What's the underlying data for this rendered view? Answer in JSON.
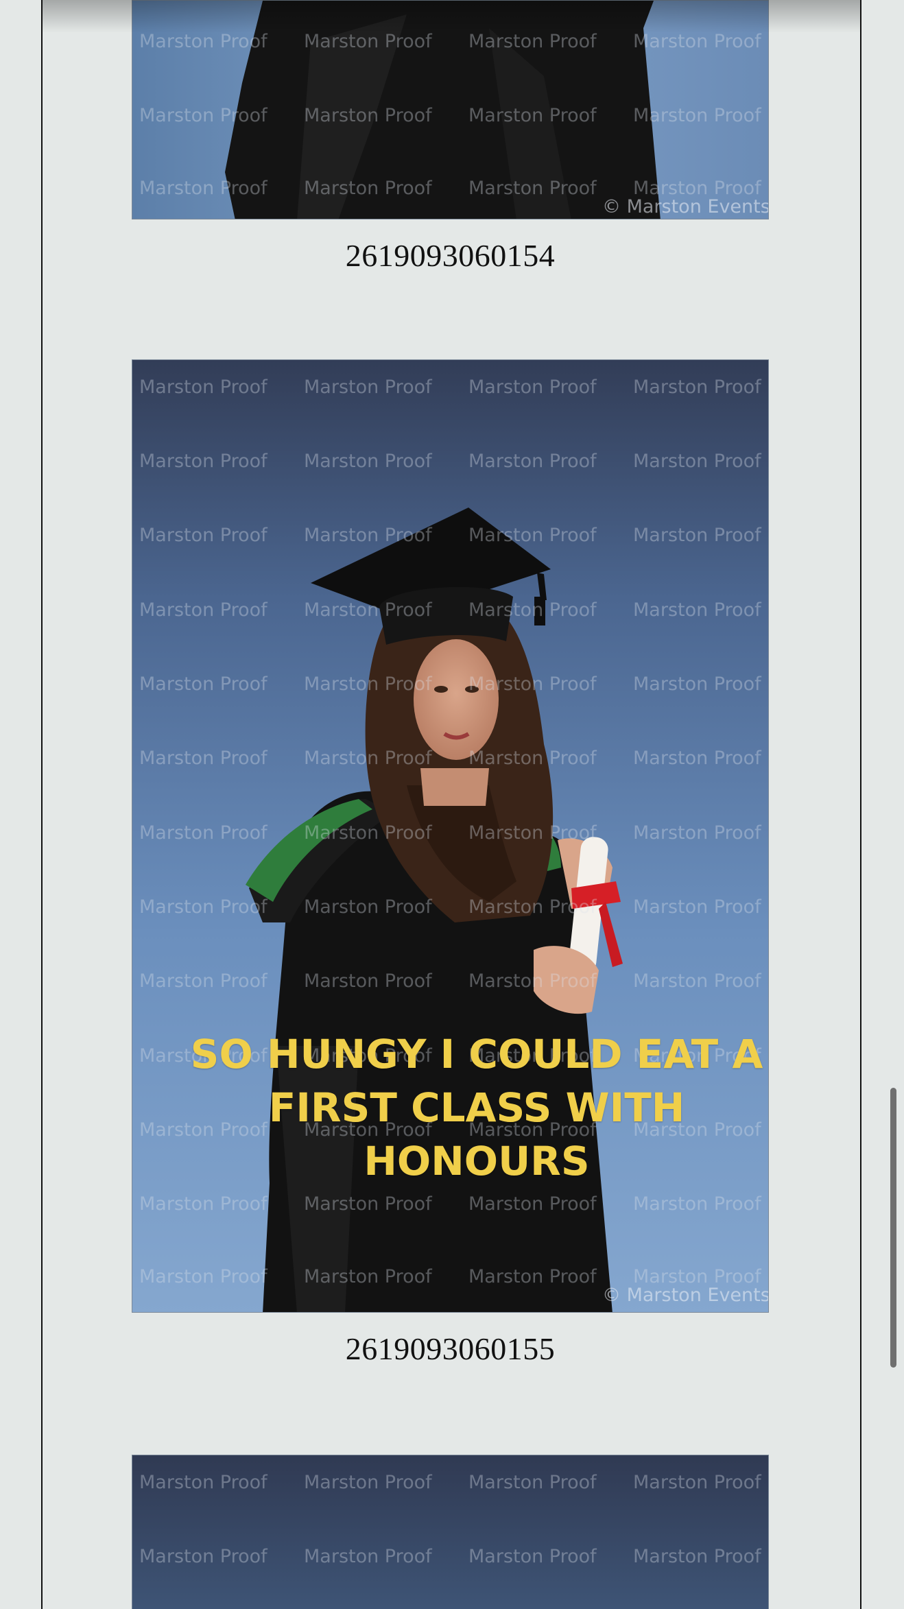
{
  "gallery": {
    "watermark_text": "Marston Proof",
    "copyright_text": "© Marston Events",
    "photos": [
      {
        "caption": "2619093060154"
      },
      {
        "caption": "2619093060155",
        "overlay_text": "SO HUNGY I COULD EAT A FIRST CLASS WITH HONOURS"
      },
      {
        "caption": ""
      }
    ]
  },
  "colors": {
    "page_background": "#e4e8e7",
    "overlay_text": "#f0cf4a",
    "backdrop_top": "#3a4a6a",
    "backdrop_bottom": "#7fa2cc"
  }
}
